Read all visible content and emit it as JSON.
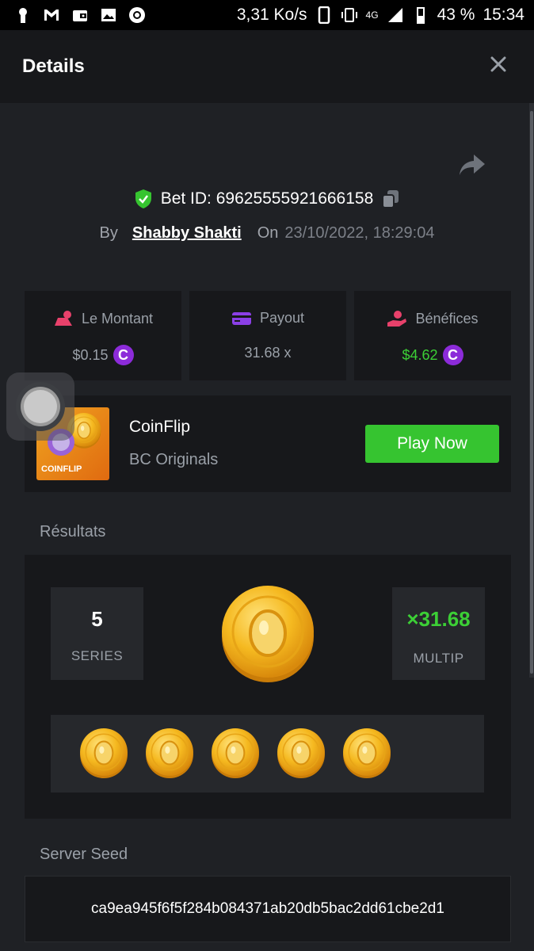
{
  "status_bar": {
    "speed": "3,31 Ko/s",
    "battery": "43 %",
    "time": "15:34",
    "network": "4G"
  },
  "header": {
    "title": "Details"
  },
  "bet": {
    "id_label": "Bet ID: 69625555921666158",
    "by_label": "By",
    "user": "Shabby Shakti",
    "on_label": "On",
    "date": "23/10/2022, 18:29:04"
  },
  "stats": {
    "amount_label": "Le Montant",
    "amount_value": "$0.15",
    "payout_label": "Payout",
    "payout_value": "31.68 x",
    "profit_label": "Bénéfices",
    "profit_value": "$4.62",
    "currency_symbol": "C"
  },
  "game": {
    "name": "CoinFlip",
    "provider": "BC Originals",
    "thumb_label": "COINFLIP",
    "play_label": "Play Now"
  },
  "results": {
    "section_label": "Résultats",
    "series_value": "5",
    "series_label": "SERIES",
    "multiplier_value": "×31.68",
    "multiplier_label": "MULTIP",
    "coin_count": 5
  },
  "seed": {
    "section_label": "Server Seed",
    "value": "ca9ea945f6f5f284b084371ab20db5bac2dd61cbe2d1"
  },
  "colors": {
    "accent_green": "#36c430",
    "profit_green": "#3ccf36",
    "currency_purple": "#8c2bd9",
    "coin_gold": "#f2b81f"
  }
}
